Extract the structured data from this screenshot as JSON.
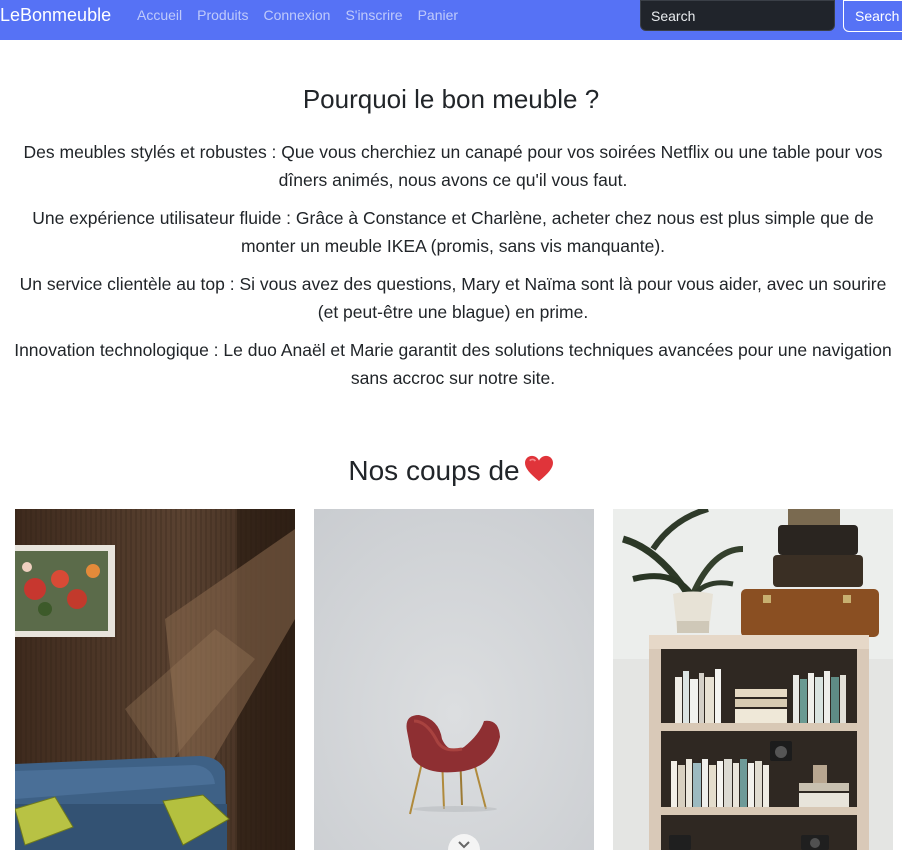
{
  "navbar": {
    "brand": "LeBonmeuble",
    "links": [
      "Accueil",
      "Produits",
      "Connexion",
      "S'inscrire",
      "Panier"
    ],
    "search_placeholder": "Search",
    "search_button": "Search",
    "background_color": "#5672f5"
  },
  "about": {
    "title": "Pourquoi le bon meuble ?",
    "paragraphs": [
      "Des meubles stylés et robustes : Que vous cherchiez un canapé pour vos soirées Netflix ou une table pour vos dîners animés, nous avons ce qu'il vous faut.",
      "Une expérience utilisateur fluide : Grâce à Constance et Charlène, acheter chez nous est plus simple que de monter un meuble IKEA (promis, sans vis manquante).",
      "Un service clientèle au top : Si vous avez des questions, Mary et Naïma sont là pour vous aider, avec un sourire (et peut-être une blague) en prime.",
      "Innovation technologique : Le duo Anaël et Marie garantit des solutions techniques avancées pour une navigation sans accroc sur notre site."
    ]
  },
  "favorites": {
    "title": "Nos coups de",
    "title_icon": "heart-icon",
    "products": [
      {
        "image": "blue-sofa-photo"
      },
      {
        "image": "red-chair-photo"
      },
      {
        "image": "bookshelf-photo"
      }
    ]
  }
}
